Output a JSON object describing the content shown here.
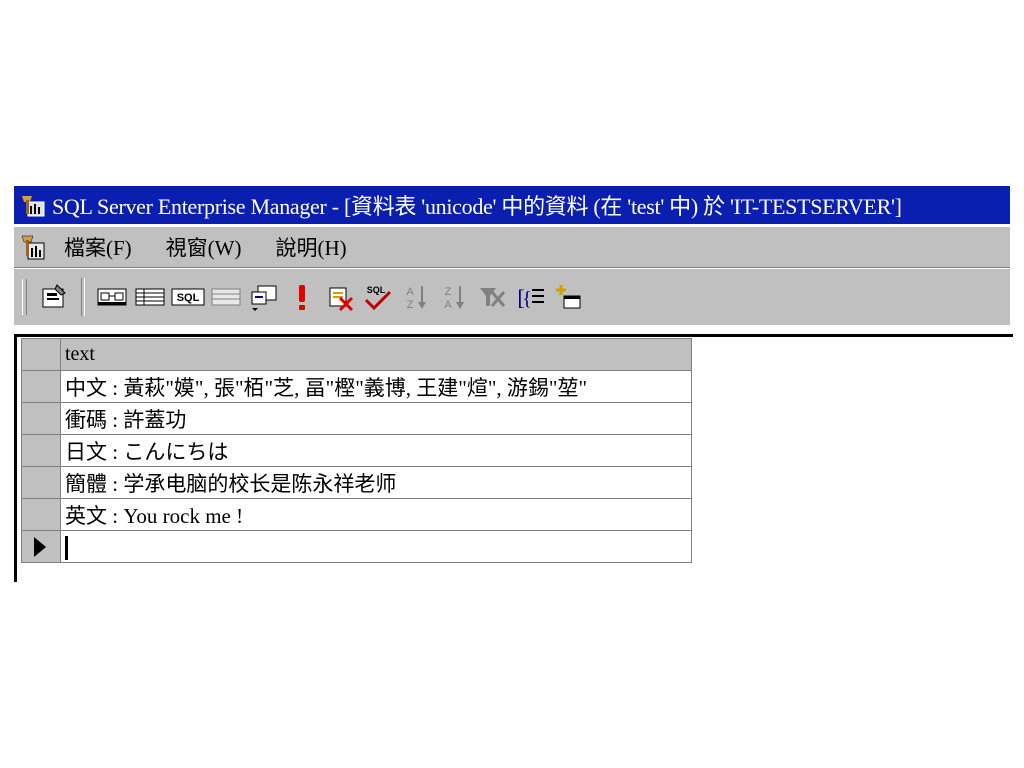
{
  "window": {
    "title": "SQL Server Enterprise Manager - [資料表 'unicode' 中的資料 (在 'test' 中) 於 'IT-TESTSERVER']"
  },
  "menubar": {
    "items": [
      {
        "label": "檔案(F)"
      },
      {
        "label": "視窗(W)"
      },
      {
        "label": "說明(H)"
      }
    ]
  },
  "toolbar": {
    "icons": [
      "properties-icon",
      "diagram-pane-icon",
      "grid-pane-icon",
      "sql-pane-icon",
      "results-pane-icon",
      "change-query-type-icon",
      "run-icon",
      "cancel-query-icon",
      "verify-sql-icon",
      "sort-ascending-icon",
      "sort-descending-icon",
      "remove-filter-icon",
      "group-by-icon",
      "add-table-icon"
    ],
    "sql_label": "SQL"
  },
  "grid": {
    "column": "text",
    "rows": [
      "中文 : 黃萩\"嫫\", 張\"栢\"芝, 畐\"樫\"義博, 王建\"煊\", 游錫\"堃\"",
      "衝碼 : 許蓋功",
      "日文 : こんにちは",
      "簡體 : 学承电脑的校长是陈永祥老师",
      "英文 : You rock me !"
    ],
    "new_row": ""
  },
  "colors": {
    "titlebar": "#0a1fb0",
    "chrome": "#c0c0c0"
  }
}
